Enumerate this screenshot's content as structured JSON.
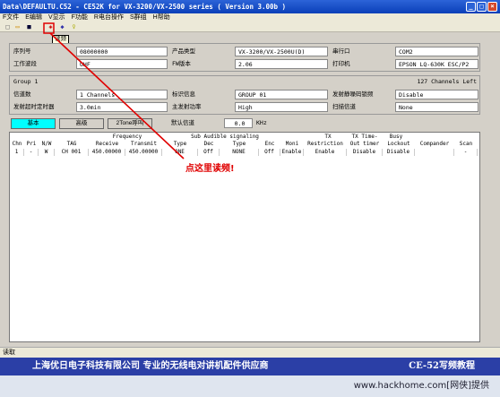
{
  "window": {
    "title": "Data\\DEFAULTU.C52 - CE52K for VX-3200/VX-2500 series ( Version 3.00b )",
    "buttons": {
      "min": "_",
      "max": "□",
      "close": "×"
    }
  },
  "menu": [
    "F文件",
    "E编辑",
    "V显示",
    "F功能",
    "R电台操作",
    "S群组",
    "H帮助"
  ],
  "toolbar": {
    "icons": [
      "new-icon",
      "open-icon",
      "save-icon",
      "read-radio-icon",
      "write-radio-icon",
      "help-bulb-icon"
    ],
    "tooltip": "读频"
  },
  "general": {
    "serial_label": "序列号",
    "serial_value": "08000000",
    "product_label": "产品类型",
    "product_value": "VX-3200/VX-2500U(D)",
    "port_label": "串行口",
    "port_value": "COM2",
    "band_label": "工作波段",
    "band_value": "UHF",
    "fw_label": "FW版本",
    "fw_value": "2.06",
    "printer_label": "打印机",
    "printer_value": "EPSON LQ-630K ESC/P2"
  },
  "group": {
    "label": "Group   1",
    "channels_left": "127  Channels Left",
    "channel_count_label": "信道数",
    "channel_count_value": "1  Channels",
    "id_label": "标识信息",
    "id_value": "GROUP 01",
    "busy_label": "发射静噪码锁频",
    "busy_value": "Disable",
    "tot_label": "发射超时定时器",
    "tot_value": "3.0min",
    "power_label": "主发射功率",
    "power_value": "High",
    "scan_label": "扫描信道",
    "scan_value": "None"
  },
  "tabs": [
    {
      "label": "基本",
      "active": true
    },
    {
      "label": "高级",
      "active": false
    },
    {
      "label": "2Tone呼叫",
      "active": false
    }
  ],
  "step": {
    "label": "默认信道",
    "value": "0.0",
    "unit": "KHz"
  },
  "table": {
    "header_top": {
      "frequency": "Frequency",
      "sub_audible": "Sub Audible signaling",
      "tx": "TX",
      "tx_time": "TX Time-",
      "busy": "Busy"
    },
    "headers": [
      "Chn",
      "Pri",
      "N/W",
      "TAG",
      "Receive",
      "Transmit",
      "Type",
      "Dec",
      "Type",
      "Enc",
      "Moni",
      "Restriction",
      "Out timer",
      "Lockout",
      "Compander",
      "Scan"
    ],
    "rows": [
      [
        "1",
        "-",
        "W",
        "CH 001",
        "450.00000",
        "450.00000",
        "ONE",
        "Off",
        "NONE",
        "Off",
        "Enable",
        "Enable",
        "Disable",
        "Disable",
        "",
        "-"
      ]
    ]
  },
  "annotation": {
    "text": "点这里读频!",
    "color": "#e00000"
  },
  "status": "读取",
  "banner": {
    "left": "上海优日电子科技有限公司 专业的无线电对讲机配件供应商",
    "right": "CE-52写频教程"
  },
  "footer": "www.hackhome.com[网侠]提供"
}
